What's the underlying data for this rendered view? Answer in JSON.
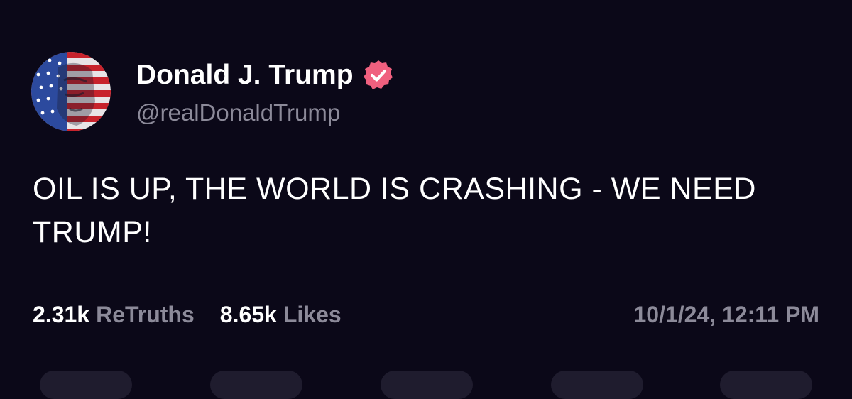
{
  "author": {
    "display_name": "Donald J. Trump",
    "handle": "@realDonaldTrump",
    "verified": true,
    "badge_color": "#f0607f"
  },
  "post": {
    "text": "OIL IS UP, THE WORLD IS CRASHING - WE NEED TRUMP!"
  },
  "stats": {
    "retruths_count": "2.31k",
    "retruths_label": "ReTruths",
    "likes_count": "8.65k",
    "likes_label": "Likes"
  },
  "timestamp": "10/1/24, 12:11 PM",
  "action_buttons": [
    "reply",
    "retruth",
    "like",
    "share",
    "more"
  ],
  "colors": {
    "background": "#0b0818",
    "text": "#ffffff",
    "muted": "#8c8a99",
    "button_bg": "#1f1c2e"
  }
}
